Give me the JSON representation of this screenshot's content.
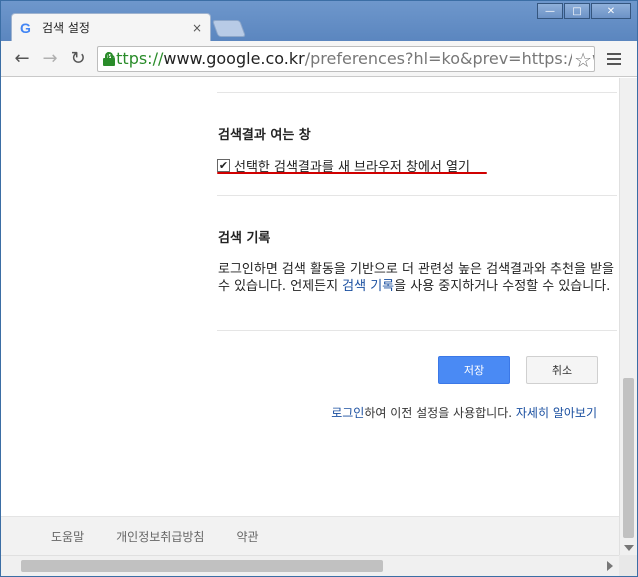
{
  "browser": {
    "tab_title": "검색 설정",
    "tab_icon_glyph": "G",
    "tab_close": "×",
    "window_minimize": "—",
    "window_maximize": "□",
    "window_close": "✕",
    "back_glyph": "←",
    "forward_glyph": "→",
    "reload_glyph": "↻",
    "url_scheme": "https://",
    "url_host": "www.google.co.kr",
    "url_path": "/preferences?hl=ko&prev=https://www",
    "bookmark_glyph": "☆"
  },
  "page": {
    "open_results": {
      "title": "검색결과 여는 창",
      "checkbox_label": "선택한 검색결과를 새 브라우저 창에서 열기",
      "checked": true,
      "check_glyph": "✔"
    },
    "history": {
      "title": "검색 기록",
      "text_before": "로그인하면 검색 활동을 기반으로 더 관련성 높은 검색결과와 추천을 받을 수 있습니다. 언제든지 ",
      "link": "검색 기록",
      "text_after": "을 사용 중지하거나 수정할 수 있습니다."
    },
    "buttons": {
      "save": "저장",
      "cancel": "취소"
    },
    "signin": {
      "link": "로그인",
      "text": "하여 이전 설정을 사용합니다. ",
      "learn_more": "자세히 알아보기"
    },
    "footer": {
      "help": "도움말",
      "privacy": "개인정보취급방침",
      "terms": "약관"
    }
  },
  "colors": {
    "accent_blue": "#4a8af4",
    "link_blue": "#1a4fa0",
    "highlight_red": "#d00000",
    "secure_green": "#2a8c2a"
  }
}
